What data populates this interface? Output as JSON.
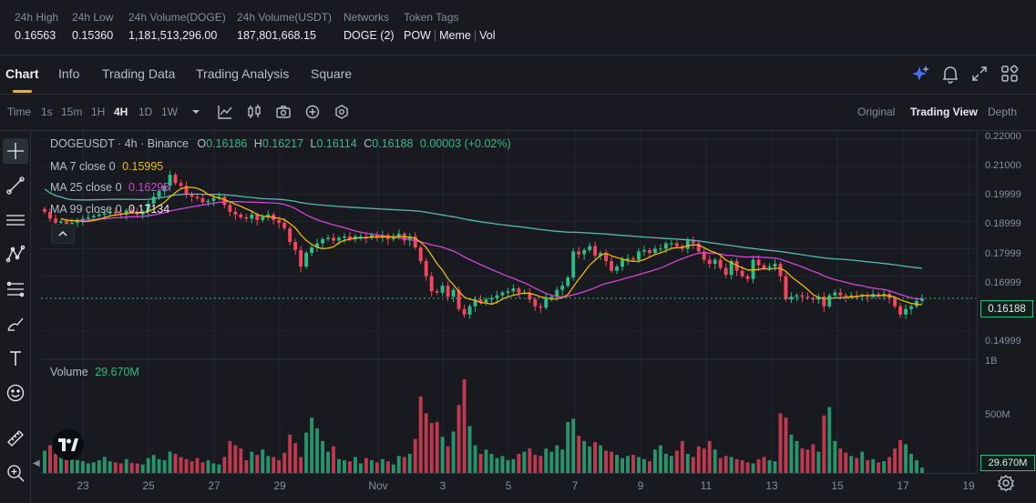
{
  "stats": [
    {
      "label": "24h High",
      "value": "0.16563"
    },
    {
      "label": "24h Low",
      "value": "0.15360"
    },
    {
      "label": "24h Volume(DOGE)",
      "value": "1,181,513,296.00"
    },
    {
      "label": "24h Volume(USDT)",
      "value": "187,801,668.15"
    },
    {
      "label": "Networks",
      "value": "DOGE (2)"
    }
  ],
  "token_tags": {
    "label": "Token Tags",
    "items": [
      "POW",
      "Meme",
      "Vol"
    ]
  },
  "tabs": [
    "Chart",
    "Info",
    "Trading Data",
    "Trading Analysis",
    "Square"
  ],
  "tab_icons": [
    "ai-sparkle-icon",
    "bell-icon",
    "expand-icon",
    "grid-layout-icon"
  ],
  "toolbar": {
    "intervals": [
      "Time",
      "1s",
      "15m",
      "1H",
      "4H",
      "1D",
      "1W"
    ],
    "active_interval": "4H",
    "icons": [
      "chevron-down-icon",
      "indicator-icon",
      "candlestick-type-icon",
      "camera-icon",
      "add-icon",
      "settings-icon"
    ],
    "views": [
      "Original",
      "Trading View",
      "Depth"
    ],
    "active_view": "Trading View"
  },
  "left_tools": [
    "crosshair-icon",
    "trend-line-icon",
    "horizontal-lines-icon",
    "pattern-icon",
    "fib-icon",
    "brush-icon",
    "text-icon",
    "emoji-icon",
    "ruler-icon",
    "zoom-icon"
  ],
  "legend": {
    "symbol": "DOGEUSDT · 4h · Binance",
    "open_label": "O",
    "open": "0.16186",
    "high_label": "H",
    "high": "0.16217",
    "low_label": "L",
    "low": "0.16114",
    "close_label": "C",
    "close": "0.16188",
    "change": "0.00003 (+0.02%)",
    "ma7_label": "MA 7 close 0",
    "ma7": "0.15995",
    "ma25_label": "MA 25 close 0",
    "ma25": "0.16296",
    "ma99_label": "MA 99 close 0",
    "ma99": "0.17134",
    "volume_label": "Volume",
    "volume": "29.670M"
  },
  "price_axis": [
    "0.22000",
    "0.21000",
    "0.19999",
    "0.18999",
    "0.17999",
    "0.16999",
    "0.14999"
  ],
  "current_price": "0.16188",
  "volume_axis": [
    "1B",
    "500M"
  ],
  "current_volume": "29.670M",
  "x_axis": [
    "23",
    "25",
    "27",
    "29",
    "Nov",
    "3",
    "5",
    "7",
    "9",
    "11",
    "13",
    "15",
    "17",
    "19"
  ],
  "colors": {
    "up": "#2ebd85",
    "down": "#f6465d",
    "ma7": "#f0b90b",
    "ma25": "#d345d7",
    "ma99": "#55b8b4",
    "accent": "#f0b90b"
  },
  "chart_data": {
    "type": "candlestick",
    "symbol": "DOGEUSDT",
    "interval": "4h",
    "close_series": [
      0.1935,
      0.191,
      0.1895,
      0.19,
      0.188,
      0.1895,
      0.1905,
      0.191,
      0.1915,
      0.192,
      0.1925,
      0.193,
      0.1935,
      0.193,
      0.1925,
      0.194,
      0.1935,
      0.1925,
      0.1935,
      0.1965,
      0.199,
      0.201,
      0.203,
      0.207,
      0.204,
      0.203,
      0.2,
      0.199,
      0.1985,
      0.197,
      0.1975,
      0.1985,
      0.199,
      0.196,
      0.1935,
      0.1925,
      0.1915,
      0.191,
      0.1925,
      0.1905,
      0.1915,
      0.1925,
      0.1905,
      0.1895,
      0.1875,
      0.1825,
      0.1795,
      0.1735,
      0.1785,
      0.1805,
      0.182,
      0.1835,
      0.184,
      0.183,
      0.184,
      0.1845,
      0.1835,
      0.1845,
      0.1845,
      0.184,
      0.185,
      0.184,
      0.185,
      0.1835,
      0.1845,
      0.1855,
      0.183,
      0.1845,
      0.1805,
      0.1755,
      0.17,
      0.1645,
      0.164,
      0.1665,
      0.1625,
      0.165,
      0.158,
      0.156,
      0.159,
      0.1615,
      0.1605,
      0.1615,
      0.162,
      0.163,
      0.164,
      0.1645,
      0.1655,
      0.164,
      0.164,
      0.1615,
      0.159,
      0.1585,
      0.162,
      0.1625,
      0.165,
      0.1665,
      0.1695,
      0.179,
      0.178,
      0.1795,
      0.181,
      0.1775,
      0.1785,
      0.1755,
      0.172,
      0.1735,
      0.176,
      0.1765,
      0.176,
      0.179,
      0.1795,
      0.1785,
      0.18,
      0.18,
      0.182,
      0.182,
      0.181,
      0.18,
      0.183,
      0.182,
      0.179,
      0.176,
      0.1745,
      0.176,
      0.173,
      0.1705,
      0.1755,
      0.172,
      0.17,
      0.169,
      0.176,
      0.174,
      0.173,
      0.1735,
      0.1745,
      0.17,
      0.1615,
      0.1625,
      0.163,
      0.1625,
      0.162,
      0.1615,
      0.1625,
      0.159,
      0.163,
      0.164,
      0.163,
      0.1625,
      0.163,
      0.1625,
      0.163,
      0.1625,
      0.1635,
      0.163,
      0.1635,
      0.162,
      0.159,
      0.156,
      0.158,
      0.159,
      0.161,
      0.1619
    ],
    "ma7_last": 0.15995,
    "ma25_last": 0.16296,
    "ma99_last": 0.17134,
    "ylim": [
      0.14,
      0.223
    ],
    "volume_ylim": [
      0,
      1060000000
    ],
    "volume_series": [
      210,
      260,
      180,
      150,
      140,
      230,
      120,
      110,
      90,
      100,
      120,
      150,
      110,
      100,
      90,
      130,
      95,
      90,
      80,
      140,
      170,
      130,
      120,
      200,
      180,
      150,
      130,
      110,
      140,
      100,
      120,
      90,
      80,
      150,
      300,
      260,
      230,
      120,
      200,
      170,
      220,
      160,
      150,
      120,
      190,
      360,
      280,
      150,
      380,
      520,
      420,
      300,
      200,
      250,
      130,
      120,
      110,
      150,
      90,
      140,
      120,
      100,
      130,
      110,
      80,
      160,
      150,
      180,
      320,
      720,
      560,
      470,
      480,
      340,
      250,
      390,
      640,
      880,
      440,
      260,
      180,
      220,
      180,
      140,
      160,
      120,
      130,
      180,
      200,
      230,
      170,
      160,
      230,
      200,
      260,
      220,
      480,
      510,
      350,
      300,
      250,
      290,
      260,
      210,
      200,
      170,
      140,
      160,
      170,
      150,
      130,
      110,
      220,
      260,
      180,
      160,
      210,
      300,
      180,
      150,
      250,
      230,
      300,
      220,
      140,
      160,
      150,
      130,
      120,
      100,
      90,
      130,
      150,
      120,
      110,
      560,
      520,
      360,
      300,
      230,
      220,
      270,
      200,
      540,
      620,
      300,
      230,
      190,
      160,
      140,
      200,
      120,
      130,
      100,
      110,
      150,
      230,
      310,
      270,
      180,
      120,
      50
    ]
  }
}
